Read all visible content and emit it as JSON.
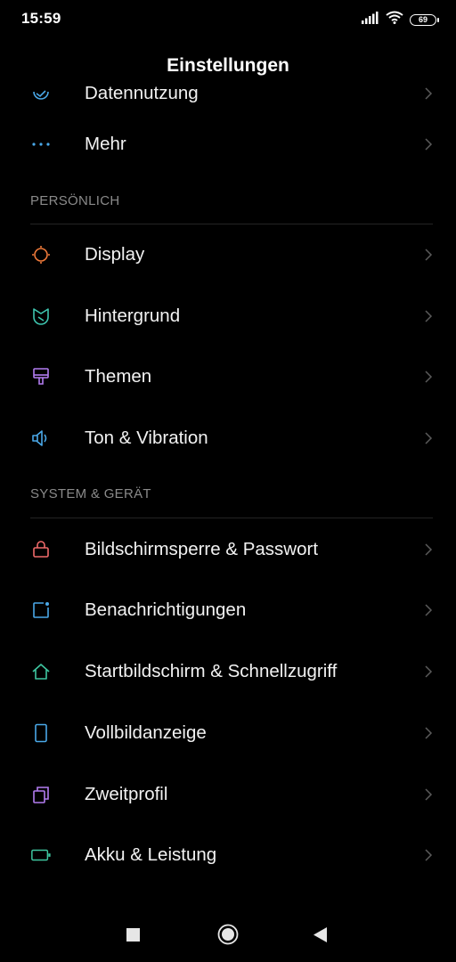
{
  "status_bar": {
    "time": "15:59",
    "battery": "69",
    "icons": [
      "signal-icon",
      "wifi-icon",
      "battery-icon"
    ]
  },
  "header": {
    "title": "Einstellungen"
  },
  "items_top": [
    {
      "label": "Datennutzung",
      "icon": "data-usage-icon",
      "color": "#4aa8e8"
    },
    {
      "label": "Mehr",
      "icon": "more-icon",
      "color": "#4aa8e8"
    }
  ],
  "section_personal": {
    "label": "PERSÖNLICH",
    "items": [
      {
        "label": "Display",
        "icon": "display-brightness-icon",
        "color": "#f07a3a"
      },
      {
        "label": "Hintergrund",
        "icon": "wallpaper-icon",
        "color": "#3ec6b0"
      },
      {
        "label": "Themen",
        "icon": "themes-brush-icon",
        "color": "#b27cf0"
      },
      {
        "label": "Ton & Vibration",
        "icon": "sound-icon",
        "color": "#4aa8e8"
      }
    ]
  },
  "section_system": {
    "label": "SYSTEM & GERÄT",
    "items": [
      {
        "label": "Bildschirmsperre & Passwort",
        "icon": "lock-icon",
        "color": "#f06a6a"
      },
      {
        "label": "Benachrichtigungen",
        "icon": "notifications-icon",
        "color": "#4aa8e8"
      },
      {
        "label": "Startbildschirm & Schnellzugriff",
        "icon": "home-icon",
        "color": "#3ec6a0"
      },
      {
        "label": "Vollbildanzeige",
        "icon": "fullscreen-phone-icon",
        "color": "#4aa8e8"
      },
      {
        "label": "Zweitprofil",
        "icon": "second-space-icon",
        "color": "#b27cf0"
      },
      {
        "label": "Akku & Leistung",
        "icon": "battery-performance-icon",
        "color": "#3ec6a0"
      }
    ]
  },
  "nav_bar": {
    "buttons": [
      "recents-icon",
      "home-circle-icon",
      "back-icon"
    ]
  }
}
